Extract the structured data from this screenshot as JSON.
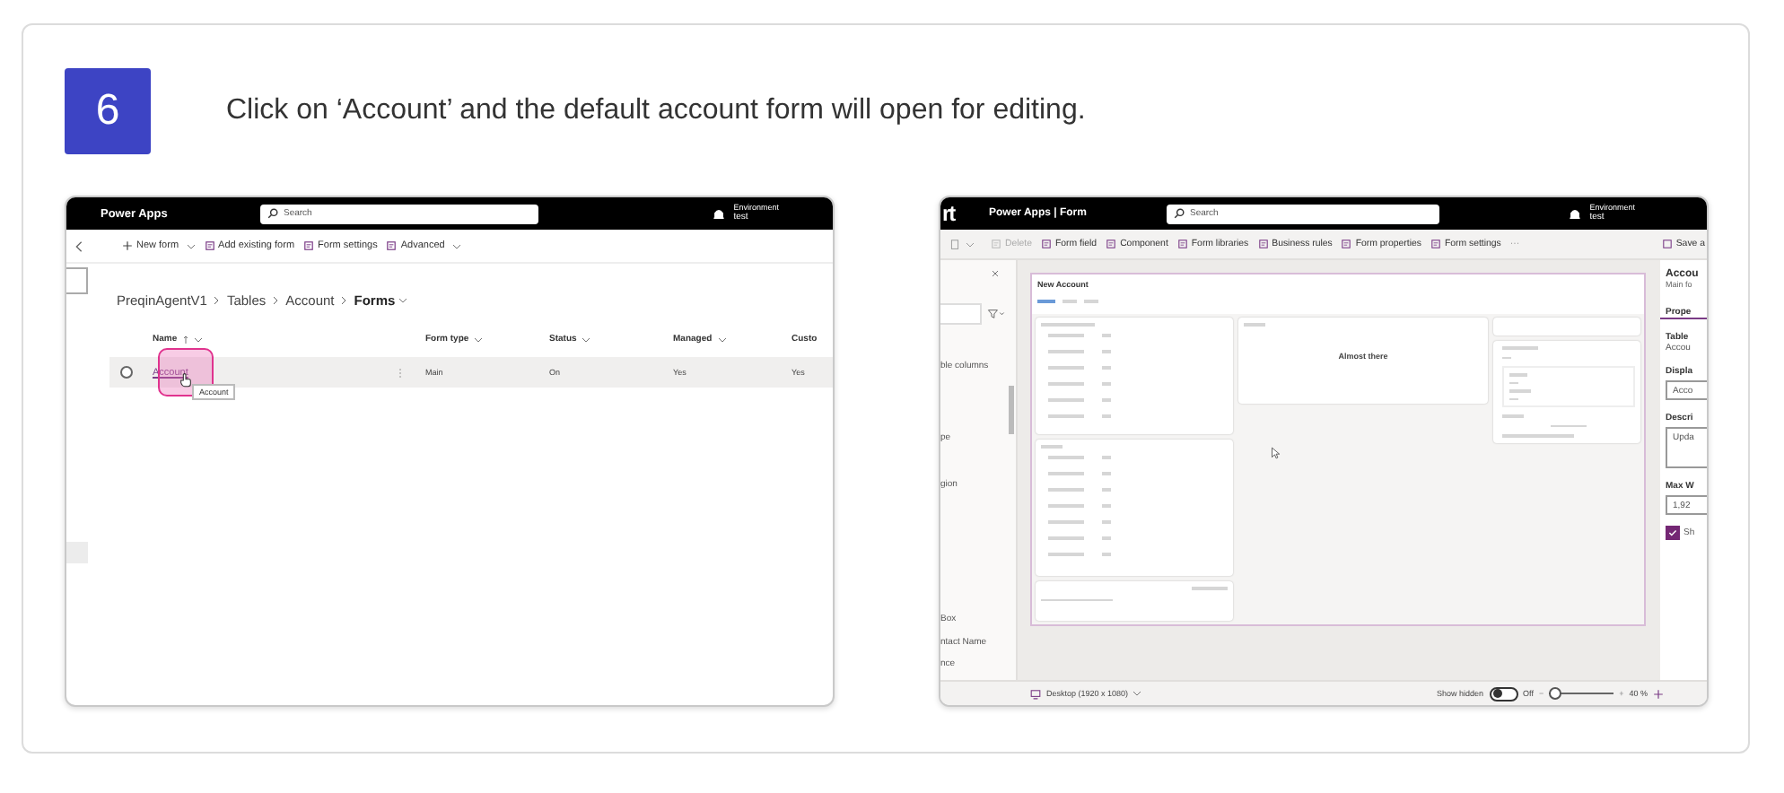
{
  "step": {
    "number": "6",
    "instruction": "Click on ‘Account’ and the default account form will open for editing."
  },
  "list_screenshot": {
    "app_title": "Power Apps",
    "search_placeholder": "Search",
    "environment_label": "Environment",
    "environment_name": "test",
    "toolbar": [
      {
        "label": "New form",
        "dropdown": true
      },
      {
        "label": "Add existing form",
        "dropdown": false
      },
      {
        "label": "Form settings",
        "dropdown": false
      },
      {
        "label": "Advanced",
        "dropdown": true
      }
    ],
    "breadcrumb": [
      {
        "label": "PreqinAgentV1",
        "current": false
      },
      {
        "label": "Tables",
        "current": false
      },
      {
        "label": "Account",
        "current": false
      },
      {
        "label": "Forms",
        "current": true
      }
    ],
    "columns": [
      {
        "label": "Name",
        "sorted": true,
        "dropdown": true
      },
      {
        "label": "Form type",
        "sorted": false,
        "dropdown": true
      },
      {
        "label": "Status",
        "sorted": false,
        "dropdown": true
      },
      {
        "label": "Managed",
        "sorted": false,
        "dropdown": true
      },
      {
        "label": "Custo",
        "sorted": false,
        "dropdown": false
      }
    ],
    "rows": [
      {
        "cells": [
          "Account",
          "Main",
          "On",
          "Yes",
          "Yes"
        ],
        "selected": false,
        "highlighted": true
      }
    ],
    "tooltip": "Account"
  },
  "designer_screenshot": {
    "logo": "rt",
    "app_title": "Power Apps | Form",
    "search_placeholder": "Search",
    "environment_label": "Environment",
    "environment_name": "test",
    "toolbar": [
      {
        "label": "Delete",
        "disabled": true
      },
      {
        "label": "Form field",
        "disabled": false
      },
      {
        "label": "Component",
        "disabled": false
      },
      {
        "label": "Form libraries",
        "disabled": false
      },
      {
        "label": "Business rules",
        "disabled": false
      },
      {
        "label": "Form properties",
        "disabled": false
      },
      {
        "label": "Form settings",
        "disabled": false
      }
    ],
    "more": "···",
    "save_label": "Save a",
    "left_pane": [
      "ble columns",
      "pe",
      "gion",
      "Box",
      "ntact Name",
      "nce"
    ],
    "form": {
      "title": "New Account",
      "timeline_text": "Almost there"
    },
    "properties": {
      "title": "Accou",
      "subtitle": "Main fo",
      "tab": "Prope",
      "table_label": "Table",
      "table_value": "Accou",
      "display_label": "Displa",
      "display_value": "Acco",
      "description_label": "Descri",
      "description_value": "Upda",
      "max_width_label": "Max W",
      "max_width_value": "1,92",
      "checkbox": {
        "label": "Sh",
        "checked": true
      }
    },
    "status_bar": {
      "device": "Desktop (1920 x 1080)",
      "show_hidden": "Show hidden",
      "toggle": {
        "on": false,
        "label": "Off"
      },
      "zoom_out": "−",
      "zoom_in": "+",
      "zoom": {
        "level": 0.1
      },
      "zoom_reading": "40 %"
    }
  }
}
